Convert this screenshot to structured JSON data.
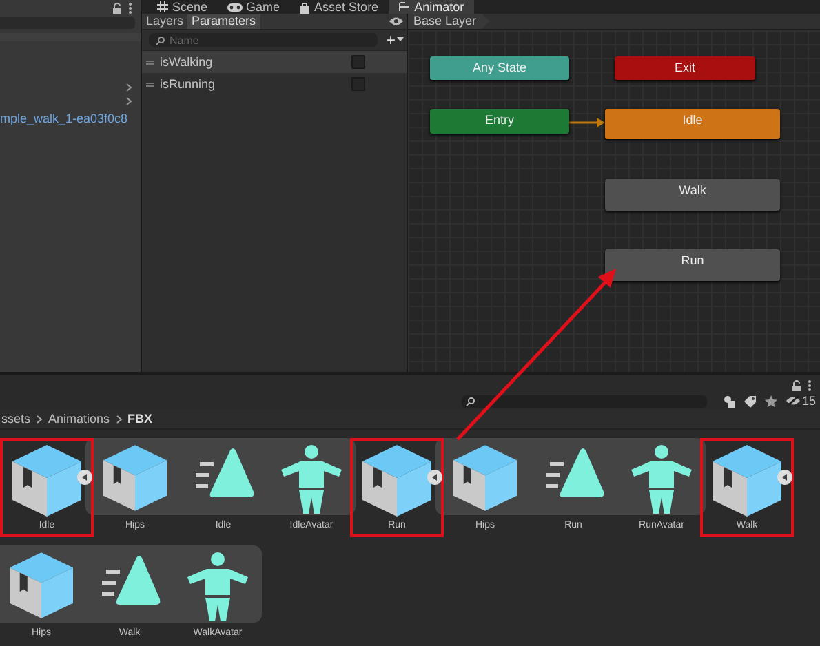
{
  "hierarchy": {
    "link_text": "mple_walk_1-ea03f0c8"
  },
  "tabs": [
    {
      "label": "Scene",
      "selected": false
    },
    {
      "label": "Game",
      "selected": false
    },
    {
      "label": "Asset Store",
      "selected": false
    },
    {
      "label": "Animator",
      "selected": true
    }
  ],
  "animator": {
    "subtabs": [
      {
        "label": "Layers",
        "selected": false
      },
      {
        "label": "Parameters",
        "selected": true
      }
    ],
    "search": {
      "placeholder": "Name"
    },
    "add_button": "+",
    "parameters": [
      {
        "name": "isWalking",
        "checked": false,
        "selected": true
      },
      {
        "name": "isRunning",
        "checked": false,
        "selected": false
      }
    ],
    "breadcrumb": "Base Layer",
    "states": [
      {
        "label": "Any State",
        "kind": "any"
      },
      {
        "label": "Exit",
        "kind": "exit"
      },
      {
        "label": "Entry",
        "kind": "entry"
      },
      {
        "label": "Idle",
        "kind": "default"
      },
      {
        "label": "Walk",
        "kind": "state"
      },
      {
        "label": "Run",
        "kind": "state"
      }
    ]
  },
  "project": {
    "hidden_count": "15",
    "breadcrumb": [
      "ssets",
      "Animations",
      "FBX"
    ],
    "assets": [
      {
        "name": "Idle",
        "highlighted": true,
        "expanded": true,
        "children": [
          {
            "name": "Hips",
            "kind": "mesh"
          },
          {
            "name": "Idle",
            "kind": "clip"
          },
          {
            "name": "IdleAvatar",
            "kind": "avatar"
          }
        ]
      },
      {
        "name": "Run",
        "highlighted": true,
        "expanded": true,
        "children": [
          {
            "name": "Hips",
            "kind": "mesh"
          },
          {
            "name": "Run",
            "kind": "clip"
          },
          {
            "name": "RunAvatar",
            "kind": "avatar"
          }
        ]
      },
      {
        "name": "Walk",
        "highlighted": true,
        "expanded": true,
        "children": [
          {
            "name": "Hips",
            "kind": "mesh"
          },
          {
            "name": "Walk",
            "kind": "clip"
          },
          {
            "name": "WalkAvatar",
            "kind": "avatar"
          }
        ]
      }
    ]
  }
}
